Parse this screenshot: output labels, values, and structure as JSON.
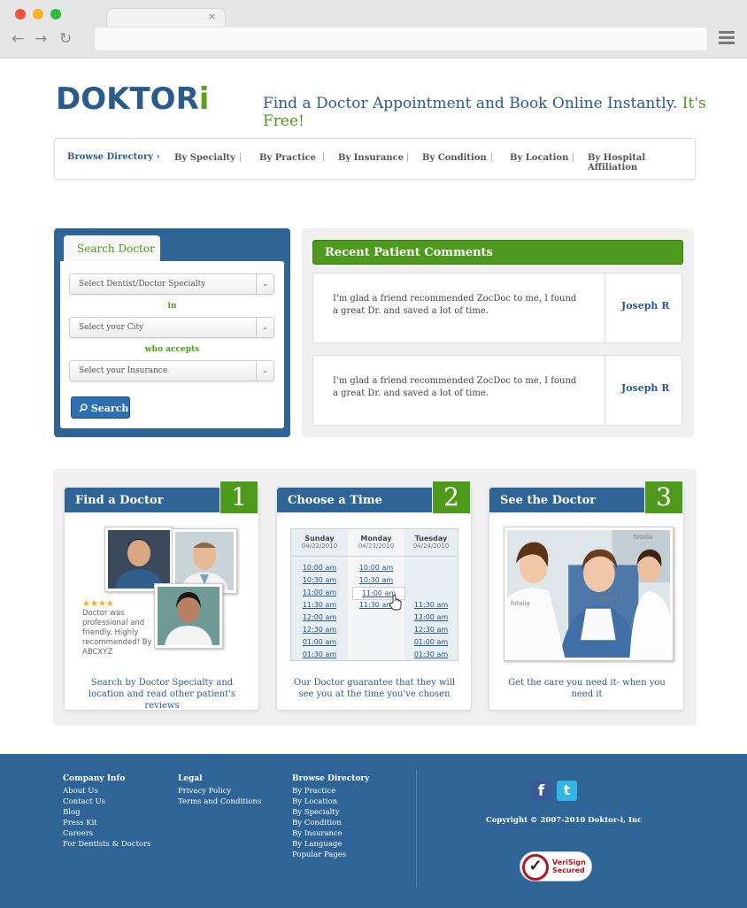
{
  "browser": {
    "tab_close": "×",
    "back": "←",
    "forward": "→",
    "reload": "↻"
  },
  "brand": {
    "logo_main": "DOKTOR",
    "logo_accent": "i"
  },
  "header": {
    "tagline": "Find a Doctor Appointment and Book Online Instantly.",
    "tagline_accent": "It's Free!"
  },
  "nav": {
    "browse": "Browse Directory ›",
    "items": [
      "By Specialty",
      "By Practice",
      "By Insurance",
      "By Condition",
      "By Location",
      "By Hospital Affiliation"
    ],
    "separator": "|"
  },
  "search": {
    "tab": "Search Doctor",
    "specialty_placeholder": "Select Dentist/Doctor Specialty",
    "in_label": "in",
    "city_placeholder": "Select your City",
    "accepts_label": "who accepts",
    "insurance_placeholder": "Select your Insurance",
    "button": "Search",
    "dropdown_arrow": "⌄"
  },
  "comments": {
    "title": "Recent Patient Comments",
    "items": [
      {
        "text": "I'm glad a friend recommended ZocDoc to me, I found a great Dr. and saved a lot of time.",
        "name": "Joseph R"
      },
      {
        "text": "I'm glad a friend recommended ZocDoc to me, I found a great Dr. and saved a lot of time.",
        "name": "Joseph R"
      }
    ]
  },
  "steps": [
    {
      "title": "Find a Doctor",
      "number": "1",
      "caption": "Search by Doctor Specialty and location and read other patient's reviews"
    },
    {
      "title": "Choose a Time",
      "number": "2",
      "caption": "Our Doctor guarantee that they will see you at the time you've chosen"
    },
    {
      "title": "See the Doctor",
      "number": "3",
      "caption": "Get the care you need it- when you need it"
    }
  ],
  "review": {
    "stars": "★★★★",
    "rating": 4,
    "text": "Doctor was professional and friendly. Highly recommended! By ABCXYZ"
  },
  "calendar": {
    "days": [
      {
        "day": "Sunday",
        "date": "04/22/2010",
        "times": [
          "10:00 am",
          "10:30 am",
          "11:00 am",
          "11:30 am",
          "12:00 am",
          "12:30 am",
          "01:00 am",
          "01:30 am"
        ]
      },
      {
        "day": "Monday",
        "date": "04/23/2010",
        "times": [
          "10:00 am",
          "10:30 am",
          "11:00 am",
          "11:30 am"
        ]
      },
      {
        "day": "Tuesday",
        "date": "04/24/2010",
        "times": [
          "11:30 am",
          "12:00 am",
          "12:30 am",
          "01:00 am",
          "01:30 am"
        ]
      }
    ],
    "selected": "11:00 am"
  },
  "photo_watermark": "fotolia",
  "footer": {
    "company": {
      "title": "Company Info",
      "links": [
        "About Us",
        "Contact Us",
        "Blog",
        "Press Kit",
        "Careers",
        "For Dentists & Doctors"
      ]
    },
    "legal": {
      "title": "Legal",
      "links": [
        "Privacy Policy",
        "Terms and Conditions"
      ]
    },
    "browse": {
      "title": "Browse Directory",
      "links": [
        "By Practice",
        "By Location",
        "By Specialty",
        "By Condition",
        "By Insurance",
        "By Language",
        "Popular Pages"
      ]
    },
    "copyright": "Copyright © 2007-2010 Doktor-i, Inc",
    "verisign_line1": "VeriSign",
    "verisign_line2": "Secured",
    "facebook_glyph": "f",
    "twitter_glyph": "t"
  },
  "colors": {
    "brand_blue": "#2e6496",
    "brand_green": "#4d9a1c"
  }
}
